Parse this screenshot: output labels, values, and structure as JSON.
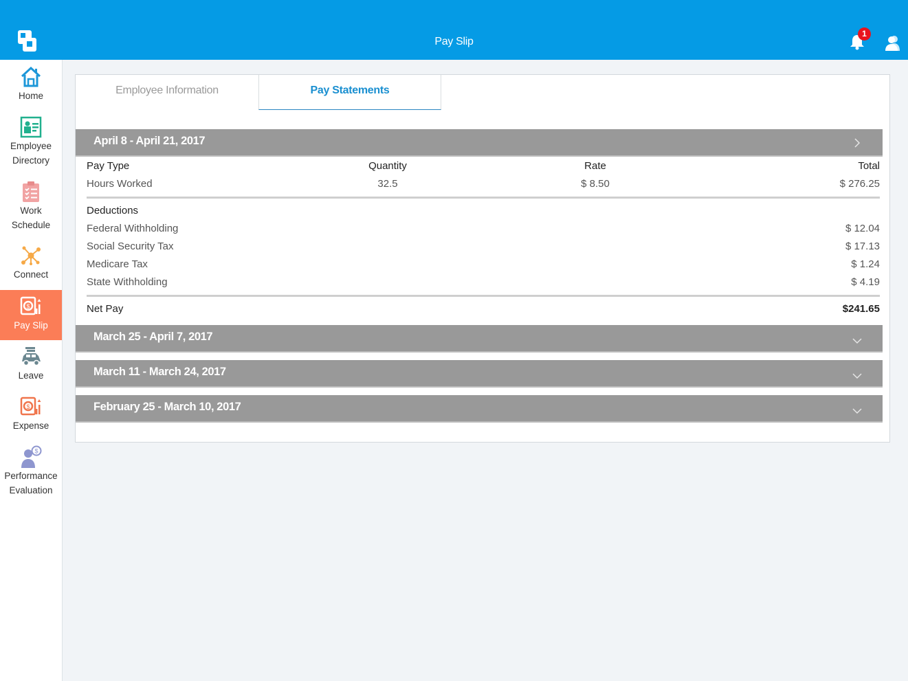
{
  "header": {
    "title": "Pay Slip",
    "notification_count": "1",
    "colors": {
      "brand": "#059be5",
      "badge": "#e8131e",
      "active_nav": "#fb7d57"
    }
  },
  "sidebar": {
    "items": [
      {
        "label1": "Home",
        "label2": "",
        "icon": "home-icon"
      },
      {
        "label1": "Employee",
        "label2": "Directory",
        "icon": "id-card-icon"
      },
      {
        "label1": "Work",
        "label2": "Schedule",
        "icon": "clipboard-icon"
      },
      {
        "label1": "Connect",
        "label2": "",
        "icon": "network-icon"
      },
      {
        "label1": "Pay Slip",
        "label2": "",
        "icon": "safe-icon",
        "active": true
      },
      {
        "label1": "Leave",
        "label2": "",
        "icon": "car-icon"
      },
      {
        "label1": "Expense",
        "label2": "",
        "icon": "expense-icon"
      },
      {
        "label1": "Performance",
        "label2": "Evaluation",
        "icon": "person-badge-icon"
      }
    ]
  },
  "tabs": [
    {
      "label": "Employee Information",
      "active": false
    },
    {
      "label": "Pay Statements",
      "active": true
    }
  ],
  "statements": [
    {
      "period": "April 8 - April 21, 2017",
      "expanded": true,
      "columns": [
        "Pay Type",
        "Quantity",
        "Rate",
        "Total"
      ],
      "earnings": [
        {
          "type": "Hours Worked",
          "quantity": "32.5",
          "rate": "$ 8.50",
          "total": "$ 276.25"
        }
      ],
      "deductions_label": "Deductions",
      "deductions": [
        {
          "name": "Federal Withholding",
          "amount": "$ 12.04"
        },
        {
          "name": "Social Security Tax",
          "amount": "$ 17.13"
        },
        {
          "name": "Medicare Tax",
          "amount": "$ 1.24"
        },
        {
          "name": "State Withholding",
          "amount": "$ 4.19"
        }
      ],
      "net_pay_label": "Net Pay",
      "net_pay": "$241.65"
    },
    {
      "period": "March 25 - April 7, 2017",
      "expanded": false
    },
    {
      "period": "March 11 - March 24, 2017",
      "expanded": false
    },
    {
      "period": "February 25 - March 10, 2017",
      "expanded": false
    }
  ]
}
